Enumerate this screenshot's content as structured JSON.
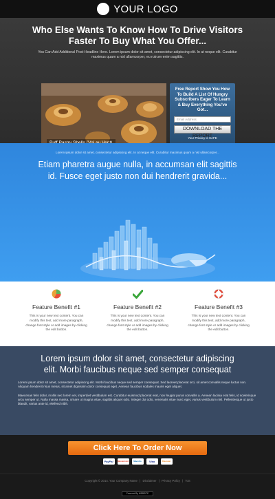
{
  "header": {
    "logo_text": "YOUR LOGO"
  },
  "hero": {
    "headline": "Who Else Wants To Know How To Drive Visitors Faster To Buy What You Offer...",
    "subheadline": "You Can Add Additional Post-Headline Here. Lorem ipsum dolor sit amet, consectetur adipiscing elit. In at neque elit. Curabitur maximus quam a nisl ullamcorper, eu rutrum enim sagittis.",
    "image_caption": "Puff Pastry Shells (Vol au Vent)",
    "optin": {
      "title": "Free Report Show You How To Build A List Of Hungry Subscribers Eager To Learn & Buy Everything You've Got...",
      "email_placeholder": "Email Address",
      "button_label": "DOWNLOAD THE REPORT",
      "privacy_text": "Your Privacy is SAFE"
    }
  },
  "blue_section": {
    "small_text": "Lorem ipsum dolor sit amet, consectetur adipiscing elit. In at neque elit. Curabitur maximus quam a nisl ullamcorper...",
    "big_text": "Etiam pharetra augue nulla, in accumsan elit sagittis id. Fusce eget justo non dui hendrerit gravida..."
  },
  "features": [
    {
      "title": "Feature Benefit #1",
      "body": "This is your new text content. You can modify this text, add more paragraph, change font style or add images by clicking the edit button.",
      "icon": "pie-chart-icon"
    },
    {
      "title": "Feature Benefit #2",
      "body": "This is your new text content. You can modify this text, add more paragraph, change font style or add images by clicking the edit button.",
      "icon": "checkmark-icon"
    },
    {
      "title": "Feature Benefit #3",
      "body": "This is your new text content. You can modify this text, add more paragraph, change font style or add images by clicking the edit button.",
      "icon": "lifebuoy-icon"
    }
  ],
  "dark_section": {
    "headline": "Lorem ipsum dolor sit amet, consectetur adipiscing elit. Morbi faucibus neque sed semper consequat",
    "para1": "Lorem ipsum dolor sit amet, consectetur adipiscing elit. Morbi faucibus neque sed semper consequat. Sed laoreet placerat orci, sit amet convallis neque luctus non. Aliquam hendrerit risus metus, sit amet dignissim dolor consequat eget. Aenean faucibus sodales mauris eget aliquet.",
    "para2": "Maecenas felis dolor, mollis nec lorem vel, imperdiet vestibulum est. Curabitur euismod placerat erat, non feugiat purus convallis a. Aenean lacinia erat felis, id scelerisque arcu semper ut. Nulla massa massa, ornare ut magna vitae, sagittis aliquet odio. Integer dui odio, venenatis vitae nunc eget, varius vestibulum nisl. Pellentesque ut justo blandit, varius ante id, eleifend nibh."
  },
  "order": {
    "button_label": "Click Here To Order Now",
    "payment_methods": [
      "PayPal",
      "Mastercard",
      "Maestro",
      "Visa",
      "Discover"
    ]
  },
  "footer": {
    "copyright": "Copyright © 2014. Your Company Name",
    "sep": "|",
    "disclaimer": "Disclaimer",
    "privacy": "Privacy Policy",
    "tos": "ToS",
    "powered": "Powered By WEBSITE"
  },
  "colors": {
    "accent_blue": "#3a93e8",
    "order_orange": "#f0801f",
    "dark_section": "#394a63"
  }
}
